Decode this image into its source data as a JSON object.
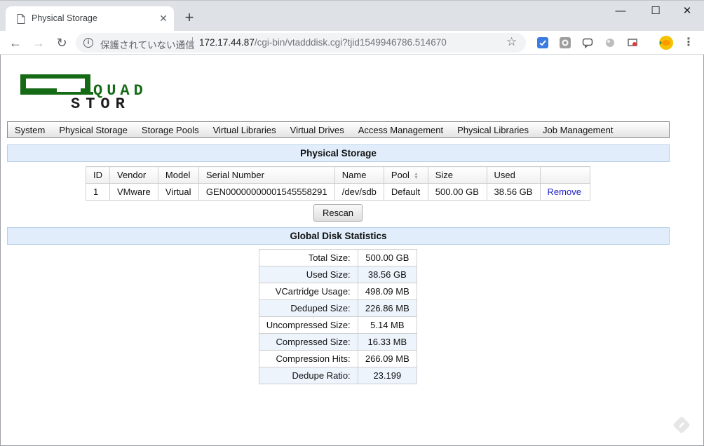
{
  "browser": {
    "tab_title": "Physical Storage",
    "new_tab_label": "+",
    "window_controls": {
      "minimize": "—",
      "maximize": "☐",
      "close": "✕"
    },
    "nav": {
      "back": "←",
      "forward": "→",
      "reload": "↻"
    },
    "address": {
      "security_text": "保護されていない通信",
      "url_host": "172.17.44.87",
      "url_path": "/cgi-bin/vtadddisk.cgi?tjid1549946786.514670"
    },
    "icons": [
      "page-icon",
      "info-icon",
      "star-icon",
      "extension-icon",
      "menu-icon"
    ],
    "colors": {
      "titlebar": "#dee1e6",
      "omnibox": "#f1f3f4"
    }
  },
  "app": {
    "logo": {
      "line1": "QUAD",
      "line2": "STOR"
    },
    "menu": [
      "System",
      "Physical Storage",
      "Storage Pools",
      "Virtual Libraries",
      "Virtual Drives",
      "Access Management",
      "Physical Libraries",
      "Job Management"
    ],
    "colors": {
      "logo_green": "#156b15",
      "section_bg": "#e1edfa",
      "link": "#1f1fc8"
    }
  },
  "physical_storage": {
    "heading": "Physical Storage",
    "columns": [
      "ID",
      "Vendor",
      "Model",
      "Serial Number",
      "Name",
      "Pool",
      "Size",
      "Used",
      ""
    ],
    "rows": [
      {
        "id": "1",
        "vendor": "VMware",
        "model": "Virtual",
        "serial": "GEN00000000001545558291",
        "name": "/dev/sdb",
        "pool": "Default",
        "size": "500.00 GB",
        "used": "38.56 GB",
        "action": "Remove"
      }
    ],
    "rescan_label": "Rescan"
  },
  "global_stats": {
    "heading": "Global Disk Statistics",
    "rows": [
      {
        "label": "Total Size:",
        "value": "500.00 GB"
      },
      {
        "label": "Used Size:",
        "value": "38.56 GB"
      },
      {
        "label": "VCartridge Usage:",
        "value": "498.09 MB"
      },
      {
        "label": "Deduped Size:",
        "value": "226.86 MB"
      },
      {
        "label": "Uncompressed Size:",
        "value": "5.14 MB"
      },
      {
        "label": "Compressed Size:",
        "value": "16.33 MB"
      },
      {
        "label": "Compression Hits:",
        "value": "266.09 MB"
      },
      {
        "label": "Dedupe Ratio:",
        "value": "23.199"
      }
    ]
  }
}
